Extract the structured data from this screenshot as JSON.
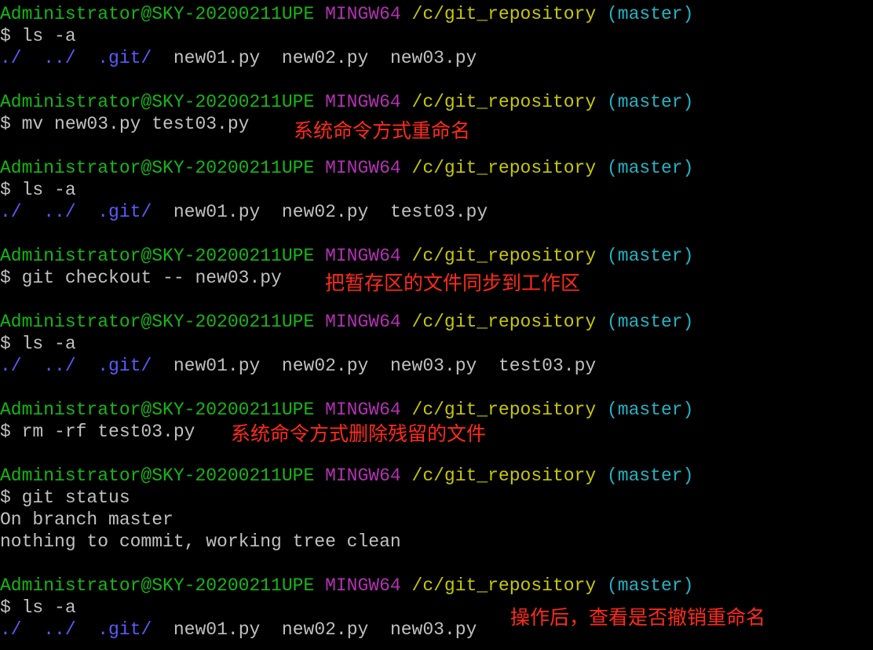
{
  "prompt": {
    "user": "Administrator@SKY-20200211UPE",
    "shell": "MINGW64",
    "path": "/c/git_repository",
    "branch": "(master)"
  },
  "blocks": [
    {
      "command": "$ ls -a",
      "output": [
        {
          "type": "ls",
          "items": [
            {
              "text": "./",
              "kind": "dir"
            },
            {
              "text": "../",
              "kind": "dir"
            },
            {
              "text": ".git/",
              "kind": "dir"
            },
            {
              "text": "new01.py",
              "kind": "file"
            },
            {
              "text": "new02.py",
              "kind": "file"
            },
            {
              "text": "new03.py",
              "kind": "file"
            }
          ]
        }
      ],
      "annotation": ""
    },
    {
      "command": "$ mv new03.py test03.py",
      "output": [],
      "annotation": "系统命令方式重命名"
    },
    {
      "command": "$ ls -a",
      "output": [
        {
          "type": "ls",
          "items": [
            {
              "text": "./",
              "kind": "dir"
            },
            {
              "text": "../",
              "kind": "dir"
            },
            {
              "text": ".git/",
              "kind": "dir"
            },
            {
              "text": "new01.py",
              "kind": "file"
            },
            {
              "text": "new02.py",
              "kind": "file"
            },
            {
              "text": "test03.py",
              "kind": "file"
            }
          ]
        }
      ],
      "annotation": ""
    },
    {
      "command": "$ git checkout -- new03.py",
      "output": [],
      "annotation": "把暂存区的文件同步到工作区"
    },
    {
      "command": "$ ls -a",
      "output": [
        {
          "type": "ls",
          "items": [
            {
              "text": "./",
              "kind": "dir"
            },
            {
              "text": "../",
              "kind": "dir"
            },
            {
              "text": ".git/",
              "kind": "dir"
            },
            {
              "text": "new01.py",
              "kind": "file"
            },
            {
              "text": "new02.py",
              "kind": "file"
            },
            {
              "text": "new03.py",
              "kind": "file"
            },
            {
              "text": "test03.py",
              "kind": "file"
            }
          ]
        }
      ],
      "annotation": ""
    },
    {
      "command": "$ rm -rf test03.py",
      "output": [],
      "annotation": "系统命令方式删除残留的文件"
    },
    {
      "command": "$ git status",
      "output": [
        {
          "type": "text",
          "text": "On branch master"
        },
        {
          "type": "text",
          "text": "nothing to commit, working tree clean"
        }
      ],
      "annotation": ""
    },
    {
      "command": "$ ls -a",
      "output": [
        {
          "type": "ls",
          "items": [
            {
              "text": "./",
              "kind": "dir"
            },
            {
              "text": "../",
              "kind": "dir"
            },
            {
              "text": ".git/",
              "kind": "dir"
            },
            {
              "text": "new01.py",
              "kind": "file"
            },
            {
              "text": "new02.py",
              "kind": "file"
            },
            {
              "text": "new03.py",
              "kind": "file"
            }
          ]
        }
      ],
      "annotation": "操作后，查看是否撤销重命名"
    }
  ],
  "colors": {
    "background": "#000000",
    "user": "#13b813",
    "shell": "#b431b4",
    "path": "#c8c800",
    "branch": "#22b3c3",
    "output": "#c0c0c0",
    "directory": "#5a5aff",
    "annotation": "#ff2a1a"
  }
}
